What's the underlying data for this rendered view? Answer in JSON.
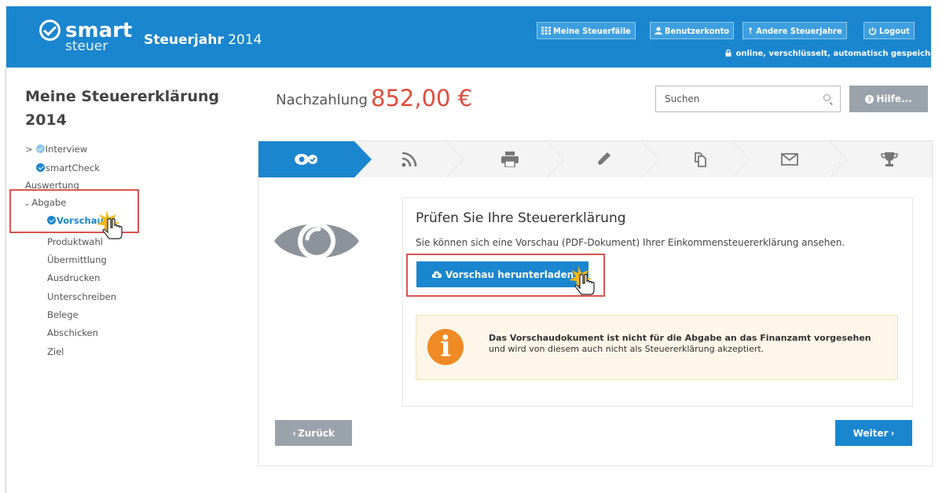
{
  "header": {
    "logo_top": "smart",
    "logo_bottom": "steuer",
    "year_label": "Steuerjahr",
    "year_value": "2014",
    "buttons": [
      {
        "label": "Meine Steuerfälle",
        "icon": "grid-icon"
      },
      {
        "label": "Benutzerkonto",
        "icon": "user-icon"
      },
      {
        "label": "Andere Steuerjahre",
        "icon": "arrow-up-icon"
      },
      {
        "label": "Logout",
        "icon": "power-icon"
      }
    ],
    "status": "online, verschlüsselt, automatisch gespeichert"
  },
  "sidebar": {
    "title": "Meine Steuererklärung 2014",
    "items": [
      {
        "label": "Interview"
      },
      {
        "label": "smartCheck"
      },
      {
        "label": "Auswertung"
      },
      {
        "label": "Abgabe"
      },
      {
        "label": "Vorschau"
      },
      {
        "label": "Produktwahl"
      },
      {
        "label": "Übermittlung"
      },
      {
        "label": "Ausdrucken"
      },
      {
        "label": "Unterschreiben"
      },
      {
        "label": "Belege"
      },
      {
        "label": "Abschicken"
      },
      {
        "label": "Ziel"
      }
    ]
  },
  "topbar": {
    "nachzahlung_label": "Nachzahlung",
    "nachzahlung_value": "852,00 €",
    "search_placeholder": "Suchen",
    "help_label": "Hilfe..."
  },
  "steps": [
    {
      "icon": "eye-check-icon",
      "active": true
    },
    {
      "icon": "rss-icon",
      "active": false
    },
    {
      "icon": "printer-icon",
      "active": false
    },
    {
      "icon": "pencil-icon",
      "active": false
    },
    {
      "icon": "documents-icon",
      "active": false
    },
    {
      "icon": "envelope-icon",
      "active": false
    },
    {
      "icon": "trophy-icon",
      "active": false
    }
  ],
  "content": {
    "title": "Prüfen Sie Ihre Steuererklärung",
    "subtitle": "Sie können sich eine Vorschau (PDF-Dokument) Ihrer Einkommensteuererklärung ansehen.",
    "download_label": "Vorschau herunterladen",
    "info_bold": "Das Vorschaudokument ist nicht für die Abgabe an das Finanzamt vorgesehen",
    "info_rest": " und wird von diesem auch nicht als Steuererklärung akzeptiert."
  },
  "footer": {
    "back_label": "Zurück",
    "next_label": "Weiter"
  },
  "colors": {
    "brand": "#1a86cf",
    "amount": "#e24b3b",
    "highlight": "#d9534f",
    "info": "#f08a24"
  }
}
